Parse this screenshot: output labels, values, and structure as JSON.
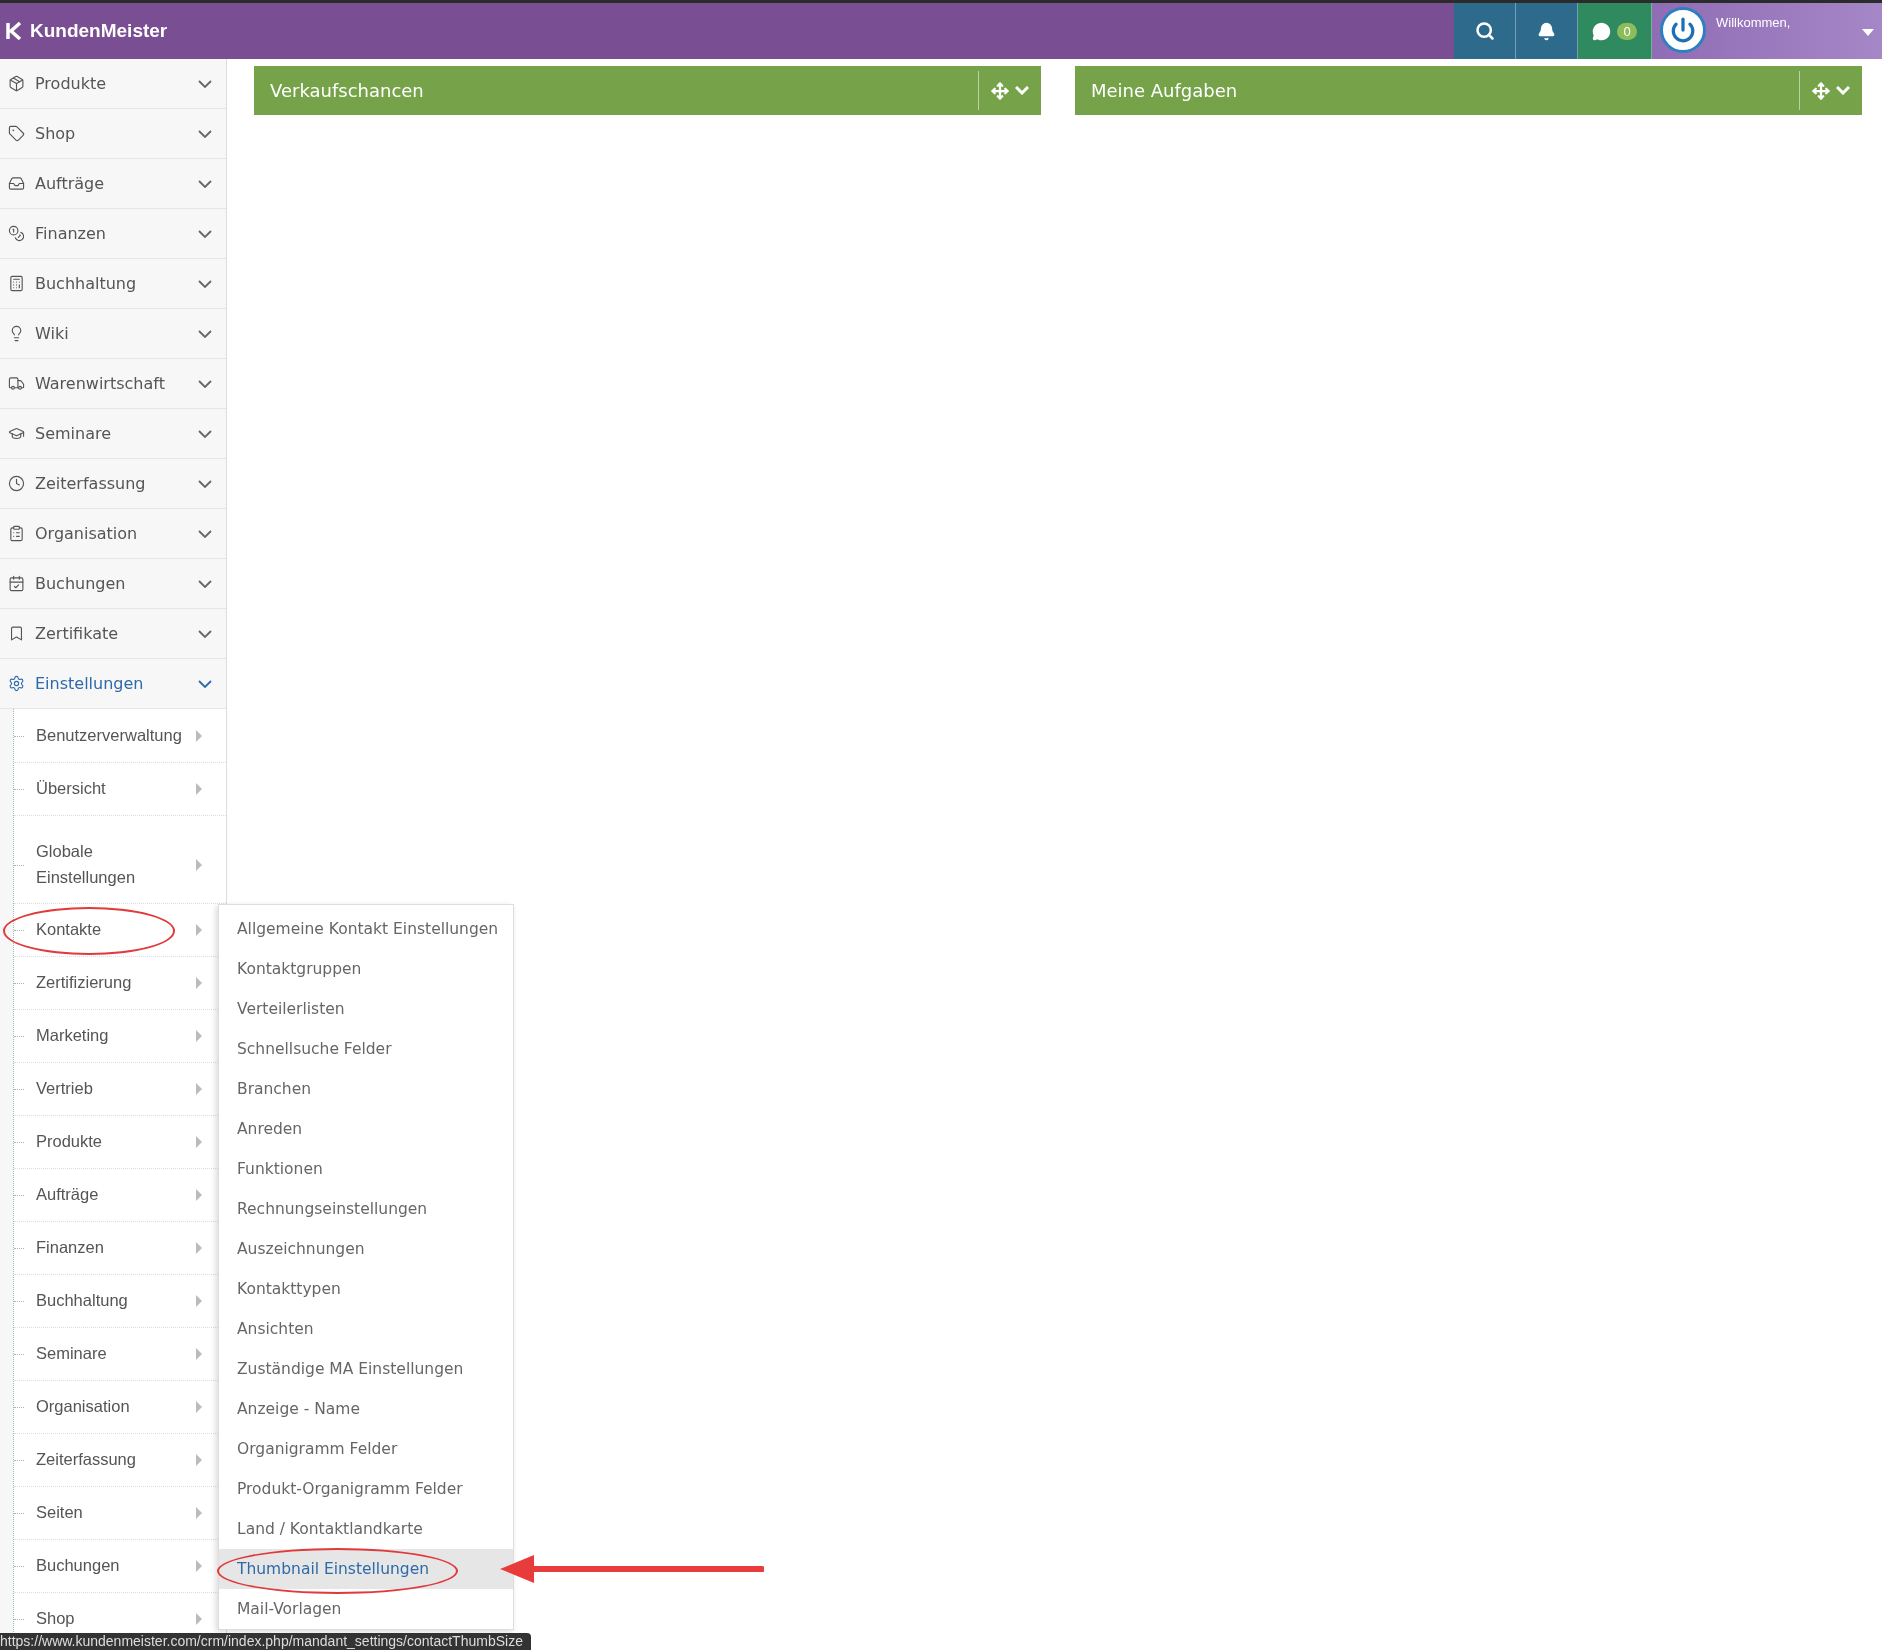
{
  "brand": "KundenMeister",
  "topbar": {
    "chat_count": "0",
    "welcome": "Willkommen,"
  },
  "panels": [
    {
      "title": "Verkaufschancen"
    },
    {
      "title": "Meine Aufgaben"
    }
  ],
  "sidebar": {
    "items": [
      {
        "label": "Produkte",
        "expanded": false
      },
      {
        "label": "Shop",
        "expanded": false
      },
      {
        "label": "Aufträge",
        "expanded": false
      },
      {
        "label": "Finanzen",
        "expanded": false
      },
      {
        "label": "Buchhaltung",
        "expanded": false
      },
      {
        "label": "Wiki",
        "expanded": false
      },
      {
        "label": "Warenwirtschaft",
        "expanded": false
      },
      {
        "label": "Seminare",
        "expanded": false
      },
      {
        "label": "Zeiterfassung",
        "expanded": false
      },
      {
        "label": "Organisation",
        "expanded": false
      },
      {
        "label": "Buchungen",
        "expanded": false
      },
      {
        "label": "Zertifikate",
        "expanded": false
      },
      {
        "label": "Einstellungen",
        "expanded": true,
        "children": [
          {
            "label": "Benutzerverwaltung",
            "circled": false
          },
          {
            "label": "Übersicht",
            "circled": false
          },
          {
            "label": "Globale Einstellungen",
            "circled": false
          },
          {
            "label": "Kontakte",
            "circled": true,
            "submenu": [
              {
                "label": "Allgemeine Kontakt Einstellungen",
                "selected": false,
                "circled": false
              },
              {
                "label": "Kontaktgruppen",
                "selected": false,
                "circled": false
              },
              {
                "label": "Verteilerlisten",
                "selected": false,
                "circled": false
              },
              {
                "label": "Schnellsuche Felder",
                "selected": false,
                "circled": false
              },
              {
                "label": "Branchen",
                "selected": false,
                "circled": false
              },
              {
                "label": "Anreden",
                "selected": false,
                "circled": false
              },
              {
                "label": "Funktionen",
                "selected": false,
                "circled": false
              },
              {
                "label": "Rechnungseinstellungen",
                "selected": false,
                "circled": false
              },
              {
                "label": "Auszeichnungen",
                "selected": false,
                "circled": false
              },
              {
                "label": "Kontakttypen",
                "selected": false,
                "circled": false
              },
              {
                "label": "Ansichten",
                "selected": false,
                "circled": false
              },
              {
                "label": "Zuständige MA Einstellungen",
                "selected": false,
                "circled": false
              },
              {
                "label": "Anzeige - Name",
                "selected": false,
                "circled": false
              },
              {
                "label": "Organigramm Felder",
                "selected": false,
                "circled": false
              },
              {
                "label": "Produkt-Organigramm Felder",
                "selected": false,
                "circled": false
              },
              {
                "label": "Land / Kontaktlandkarte",
                "selected": false,
                "circled": false
              },
              {
                "label": "Thumbnail Einstellungen",
                "selected": true,
                "circled": true
              },
              {
                "label": "Mail-Vorlagen",
                "selected": false,
                "circled": false
              }
            ]
          },
          {
            "label": "Zertifizierung",
            "circled": false
          },
          {
            "label": "Marketing",
            "circled": false
          },
          {
            "label": "Vertrieb",
            "circled": false
          },
          {
            "label": "Produkte",
            "circled": false
          },
          {
            "label": "Aufträge",
            "circled": false
          },
          {
            "label": "Finanzen",
            "circled": false
          },
          {
            "label": "Buchhaltung",
            "circled": false
          },
          {
            "label": "Seminare",
            "circled": false
          },
          {
            "label": "Organisation",
            "circled": false
          },
          {
            "label": "Zeiterfassung",
            "circled": false
          },
          {
            "label": "Seiten",
            "circled": false
          },
          {
            "label": "Buchungen",
            "circled": false
          },
          {
            "label": "Shop",
            "circled": false
          }
        ]
      }
    ]
  },
  "status_url": "https://www.kundenmeister.com/crm/index.php/mandant_settings/contactThumbSize"
}
